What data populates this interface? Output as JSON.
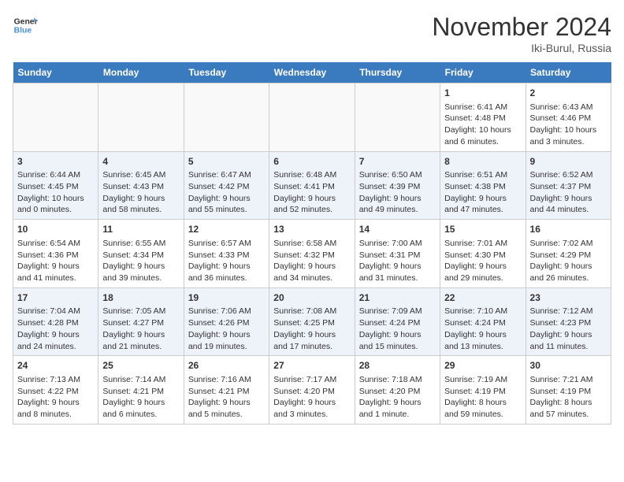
{
  "header": {
    "logo_line1": "General",
    "logo_line2": "Blue",
    "month": "November 2024",
    "location": "Iki-Burul, Russia"
  },
  "days_of_week": [
    "Sunday",
    "Monday",
    "Tuesday",
    "Wednesday",
    "Thursday",
    "Friday",
    "Saturday"
  ],
  "weeks": [
    [
      {
        "day": "",
        "content": ""
      },
      {
        "day": "",
        "content": ""
      },
      {
        "day": "",
        "content": ""
      },
      {
        "day": "",
        "content": ""
      },
      {
        "day": "",
        "content": ""
      },
      {
        "day": "1",
        "content": "Sunrise: 6:41 AM\nSunset: 4:48 PM\nDaylight: 10 hours\nand 6 minutes."
      },
      {
        "day": "2",
        "content": "Sunrise: 6:43 AM\nSunset: 4:46 PM\nDaylight: 10 hours\nand 3 minutes."
      }
    ],
    [
      {
        "day": "3",
        "content": "Sunrise: 6:44 AM\nSunset: 4:45 PM\nDaylight: 10 hours\nand 0 minutes."
      },
      {
        "day": "4",
        "content": "Sunrise: 6:45 AM\nSunset: 4:43 PM\nDaylight: 9 hours\nand 58 minutes."
      },
      {
        "day": "5",
        "content": "Sunrise: 6:47 AM\nSunset: 4:42 PM\nDaylight: 9 hours\nand 55 minutes."
      },
      {
        "day": "6",
        "content": "Sunrise: 6:48 AM\nSunset: 4:41 PM\nDaylight: 9 hours\nand 52 minutes."
      },
      {
        "day": "7",
        "content": "Sunrise: 6:50 AM\nSunset: 4:39 PM\nDaylight: 9 hours\nand 49 minutes."
      },
      {
        "day": "8",
        "content": "Sunrise: 6:51 AM\nSunset: 4:38 PM\nDaylight: 9 hours\nand 47 minutes."
      },
      {
        "day": "9",
        "content": "Sunrise: 6:52 AM\nSunset: 4:37 PM\nDaylight: 9 hours\nand 44 minutes."
      }
    ],
    [
      {
        "day": "10",
        "content": "Sunrise: 6:54 AM\nSunset: 4:36 PM\nDaylight: 9 hours\nand 41 minutes."
      },
      {
        "day": "11",
        "content": "Sunrise: 6:55 AM\nSunset: 4:34 PM\nDaylight: 9 hours\nand 39 minutes."
      },
      {
        "day": "12",
        "content": "Sunrise: 6:57 AM\nSunset: 4:33 PM\nDaylight: 9 hours\nand 36 minutes."
      },
      {
        "day": "13",
        "content": "Sunrise: 6:58 AM\nSunset: 4:32 PM\nDaylight: 9 hours\nand 34 minutes."
      },
      {
        "day": "14",
        "content": "Sunrise: 7:00 AM\nSunset: 4:31 PM\nDaylight: 9 hours\nand 31 minutes."
      },
      {
        "day": "15",
        "content": "Sunrise: 7:01 AM\nSunset: 4:30 PM\nDaylight: 9 hours\nand 29 minutes."
      },
      {
        "day": "16",
        "content": "Sunrise: 7:02 AM\nSunset: 4:29 PM\nDaylight: 9 hours\nand 26 minutes."
      }
    ],
    [
      {
        "day": "17",
        "content": "Sunrise: 7:04 AM\nSunset: 4:28 PM\nDaylight: 9 hours\nand 24 minutes."
      },
      {
        "day": "18",
        "content": "Sunrise: 7:05 AM\nSunset: 4:27 PM\nDaylight: 9 hours\nand 21 minutes."
      },
      {
        "day": "19",
        "content": "Sunrise: 7:06 AM\nSunset: 4:26 PM\nDaylight: 9 hours\nand 19 minutes."
      },
      {
        "day": "20",
        "content": "Sunrise: 7:08 AM\nSunset: 4:25 PM\nDaylight: 9 hours\nand 17 minutes."
      },
      {
        "day": "21",
        "content": "Sunrise: 7:09 AM\nSunset: 4:24 PM\nDaylight: 9 hours\nand 15 minutes."
      },
      {
        "day": "22",
        "content": "Sunrise: 7:10 AM\nSunset: 4:24 PM\nDaylight: 9 hours\nand 13 minutes."
      },
      {
        "day": "23",
        "content": "Sunrise: 7:12 AM\nSunset: 4:23 PM\nDaylight: 9 hours\nand 11 minutes."
      }
    ],
    [
      {
        "day": "24",
        "content": "Sunrise: 7:13 AM\nSunset: 4:22 PM\nDaylight: 9 hours\nand 8 minutes."
      },
      {
        "day": "25",
        "content": "Sunrise: 7:14 AM\nSunset: 4:21 PM\nDaylight: 9 hours\nand 6 minutes."
      },
      {
        "day": "26",
        "content": "Sunrise: 7:16 AM\nSunset: 4:21 PM\nDaylight: 9 hours\nand 5 minutes."
      },
      {
        "day": "27",
        "content": "Sunrise: 7:17 AM\nSunset: 4:20 PM\nDaylight: 9 hours\nand 3 minutes."
      },
      {
        "day": "28",
        "content": "Sunrise: 7:18 AM\nSunset: 4:20 PM\nDaylight: 9 hours\nand 1 minute."
      },
      {
        "day": "29",
        "content": "Sunrise: 7:19 AM\nSunset: 4:19 PM\nDaylight: 8 hours\nand 59 minutes."
      },
      {
        "day": "30",
        "content": "Sunrise: 7:21 AM\nSunset: 4:19 PM\nDaylight: 8 hours\nand 57 minutes."
      }
    ]
  ]
}
